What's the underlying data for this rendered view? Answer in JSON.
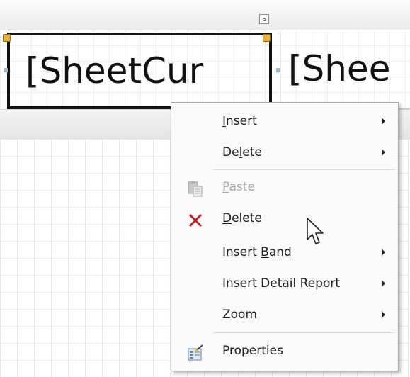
{
  "smart_tag": {
    "glyph": ">"
  },
  "cells": [
    {
      "text": "[SheetCur"
    },
    {
      "text": "[Shee"
    }
  ],
  "context_menu": {
    "items": [
      {
        "pre": "",
        "accel": "I",
        "post": "nsert",
        "has_submenu": true,
        "disabled": false,
        "icon": ""
      },
      {
        "pre": "De",
        "accel": "l",
        "post": "ete",
        "has_submenu": true,
        "disabled": false,
        "icon": ""
      },
      {
        "pre": "",
        "accel": "P",
        "post": "aste",
        "has_submenu": false,
        "disabled": true,
        "icon": "paste-icon"
      },
      {
        "pre": "",
        "accel": "D",
        "post": "elete",
        "has_submenu": false,
        "disabled": false,
        "icon": "delete-x-icon"
      },
      {
        "pre": "Insert ",
        "accel": "B",
        "post": "and",
        "has_submenu": true,
        "disabled": false,
        "icon": ""
      },
      {
        "pre": "Insert Detail Report",
        "accel": "",
        "post": "",
        "has_submenu": true,
        "disabled": false,
        "icon": ""
      },
      {
        "pre": "Zoom",
        "accel": "",
        "post": "",
        "has_submenu": true,
        "disabled": false,
        "icon": ""
      },
      {
        "pre": "P",
        "accel": "r",
        "post": "operties",
        "has_submenu": false,
        "disabled": false,
        "icon": "properties-icon"
      }
    ]
  },
  "colors": {
    "delete_icon": "#c0252b",
    "selection_border": "#111111",
    "handle": "#e8b23c"
  }
}
